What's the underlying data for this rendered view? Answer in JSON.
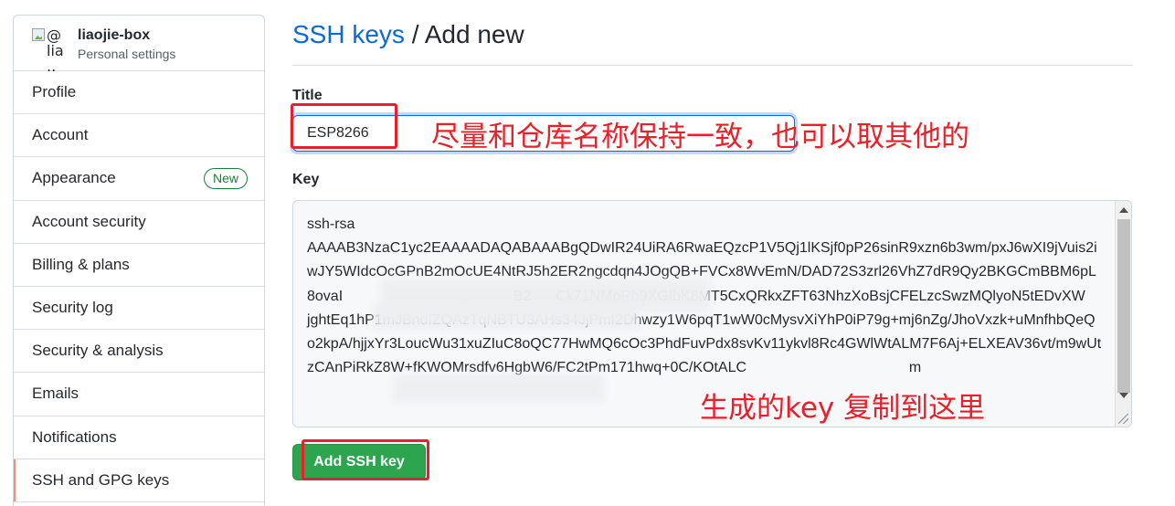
{
  "sidebar": {
    "avatar_alt": "@\nlia\n..",
    "username": "liaojie-box",
    "subtitle": "Personal settings",
    "items": [
      {
        "label": "Profile"
      },
      {
        "label": "Account"
      },
      {
        "label": "Appearance",
        "badge": "New"
      },
      {
        "label": "Account security"
      },
      {
        "label": "Billing & plans"
      },
      {
        "label": "Security log"
      },
      {
        "label": "Security & analysis"
      },
      {
        "label": "Emails"
      },
      {
        "label": "Notifications"
      },
      {
        "label": "SSH and GPG keys",
        "active": true
      }
    ]
  },
  "header": {
    "breadcrumb_link": "SSH keys",
    "separator": "/",
    "current": "Add new"
  },
  "form": {
    "title_label": "Title",
    "title_value": "ESP8266",
    "key_label": "Key",
    "key_value": "ssh-rsa\nAAAAB3NzaC1yc2EAAAADAQABAAABgQDwIR24UiRA6RwaEQzcP1V5Qj1lKSjf0pP26sinR9xzn6b3wm/pxJ6wXI9jVuis2iwJY5WIdcOcGPnB2mOcUE4NtRJ5h2ER2ngcdqn4JOgQB+FVCx8WvEmN/DAD72S3zrl26VhZ7dR9Qy2BKGCmBBM6pL8ovaI                              .           B2      Ck71NMpRh9XGIbK8MT5CxQRkxZFT63NhzXoBsjCFELzcSwzMQlyoN5tEDvXW                                                  jghtEq1hP1mJBndIZQAzTqNBTU3AHs34JjPmf2Dhwzy1W6pqT1wW0cMysvXiYhP0iP79g+mj6nZg/JhoVxzk+uMnfhbQeQo2kpA/hjjxYr3LoucWu31xuZIuC8oQC77HwMQ6cOc3PhdFuvPdx8svKv11ykvl8Rc4GWlWtALM7F6Aj+ELXEAV36vt/m9wUtzCAnPiRkZ8W+fKWOMrsdfv6HgbW6/FC2tPm171hwq+0C/KOtALC                                        m",
    "submit_label": "Add SSH key"
  },
  "annotations": {
    "title_note": "尽量和仓库名称保持一致，也可以取其他的",
    "key_note": "生成的key  复制到这里",
    "color": "#e8202a"
  },
  "colors": {
    "link": "#0969da",
    "primary_button": "#2da44e",
    "new_badge": "#1a7f37",
    "active_indicator": "#fd8c73"
  }
}
